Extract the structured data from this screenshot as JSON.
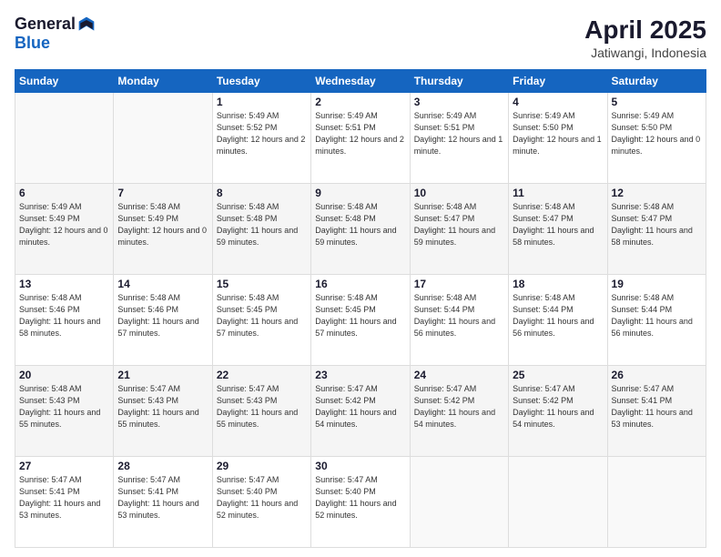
{
  "header": {
    "logo_general": "General",
    "logo_blue": "Blue",
    "title": "April 2025",
    "subtitle": "Jatiwangi, Indonesia"
  },
  "calendar": {
    "days_of_week": [
      "Sunday",
      "Monday",
      "Tuesday",
      "Wednesday",
      "Thursday",
      "Friday",
      "Saturday"
    ],
    "weeks": [
      [
        {
          "day": "",
          "info": ""
        },
        {
          "day": "",
          "info": ""
        },
        {
          "day": "1",
          "info": "Sunrise: 5:49 AM\nSunset: 5:52 PM\nDaylight: 12 hours\nand 2 minutes."
        },
        {
          "day": "2",
          "info": "Sunrise: 5:49 AM\nSunset: 5:51 PM\nDaylight: 12 hours\nand 2 minutes."
        },
        {
          "day": "3",
          "info": "Sunrise: 5:49 AM\nSunset: 5:51 PM\nDaylight: 12 hours\nand 1 minute."
        },
        {
          "day": "4",
          "info": "Sunrise: 5:49 AM\nSunset: 5:50 PM\nDaylight: 12 hours\nand 1 minute."
        },
        {
          "day": "5",
          "info": "Sunrise: 5:49 AM\nSunset: 5:50 PM\nDaylight: 12 hours\nand 0 minutes."
        }
      ],
      [
        {
          "day": "6",
          "info": "Sunrise: 5:49 AM\nSunset: 5:49 PM\nDaylight: 12 hours\nand 0 minutes."
        },
        {
          "day": "7",
          "info": "Sunrise: 5:48 AM\nSunset: 5:49 PM\nDaylight: 12 hours\nand 0 minutes."
        },
        {
          "day": "8",
          "info": "Sunrise: 5:48 AM\nSunset: 5:48 PM\nDaylight: 11 hours\nand 59 minutes."
        },
        {
          "day": "9",
          "info": "Sunrise: 5:48 AM\nSunset: 5:48 PM\nDaylight: 11 hours\nand 59 minutes."
        },
        {
          "day": "10",
          "info": "Sunrise: 5:48 AM\nSunset: 5:47 PM\nDaylight: 11 hours\nand 59 minutes."
        },
        {
          "day": "11",
          "info": "Sunrise: 5:48 AM\nSunset: 5:47 PM\nDaylight: 11 hours\nand 58 minutes."
        },
        {
          "day": "12",
          "info": "Sunrise: 5:48 AM\nSunset: 5:47 PM\nDaylight: 11 hours\nand 58 minutes."
        }
      ],
      [
        {
          "day": "13",
          "info": "Sunrise: 5:48 AM\nSunset: 5:46 PM\nDaylight: 11 hours\nand 58 minutes."
        },
        {
          "day": "14",
          "info": "Sunrise: 5:48 AM\nSunset: 5:46 PM\nDaylight: 11 hours\nand 57 minutes."
        },
        {
          "day": "15",
          "info": "Sunrise: 5:48 AM\nSunset: 5:45 PM\nDaylight: 11 hours\nand 57 minutes."
        },
        {
          "day": "16",
          "info": "Sunrise: 5:48 AM\nSunset: 5:45 PM\nDaylight: 11 hours\nand 57 minutes."
        },
        {
          "day": "17",
          "info": "Sunrise: 5:48 AM\nSunset: 5:44 PM\nDaylight: 11 hours\nand 56 minutes."
        },
        {
          "day": "18",
          "info": "Sunrise: 5:48 AM\nSunset: 5:44 PM\nDaylight: 11 hours\nand 56 minutes."
        },
        {
          "day": "19",
          "info": "Sunrise: 5:48 AM\nSunset: 5:44 PM\nDaylight: 11 hours\nand 56 minutes."
        }
      ],
      [
        {
          "day": "20",
          "info": "Sunrise: 5:48 AM\nSunset: 5:43 PM\nDaylight: 11 hours\nand 55 minutes."
        },
        {
          "day": "21",
          "info": "Sunrise: 5:47 AM\nSunset: 5:43 PM\nDaylight: 11 hours\nand 55 minutes."
        },
        {
          "day": "22",
          "info": "Sunrise: 5:47 AM\nSunset: 5:43 PM\nDaylight: 11 hours\nand 55 minutes."
        },
        {
          "day": "23",
          "info": "Sunrise: 5:47 AM\nSunset: 5:42 PM\nDaylight: 11 hours\nand 54 minutes."
        },
        {
          "day": "24",
          "info": "Sunrise: 5:47 AM\nSunset: 5:42 PM\nDaylight: 11 hours\nand 54 minutes."
        },
        {
          "day": "25",
          "info": "Sunrise: 5:47 AM\nSunset: 5:42 PM\nDaylight: 11 hours\nand 54 minutes."
        },
        {
          "day": "26",
          "info": "Sunrise: 5:47 AM\nSunset: 5:41 PM\nDaylight: 11 hours\nand 53 minutes."
        }
      ],
      [
        {
          "day": "27",
          "info": "Sunrise: 5:47 AM\nSunset: 5:41 PM\nDaylight: 11 hours\nand 53 minutes."
        },
        {
          "day": "28",
          "info": "Sunrise: 5:47 AM\nSunset: 5:41 PM\nDaylight: 11 hours\nand 53 minutes."
        },
        {
          "day": "29",
          "info": "Sunrise: 5:47 AM\nSunset: 5:40 PM\nDaylight: 11 hours\nand 52 minutes."
        },
        {
          "day": "30",
          "info": "Sunrise: 5:47 AM\nSunset: 5:40 PM\nDaylight: 11 hours\nand 52 minutes."
        },
        {
          "day": "",
          "info": ""
        },
        {
          "day": "",
          "info": ""
        },
        {
          "day": "",
          "info": ""
        }
      ]
    ]
  }
}
